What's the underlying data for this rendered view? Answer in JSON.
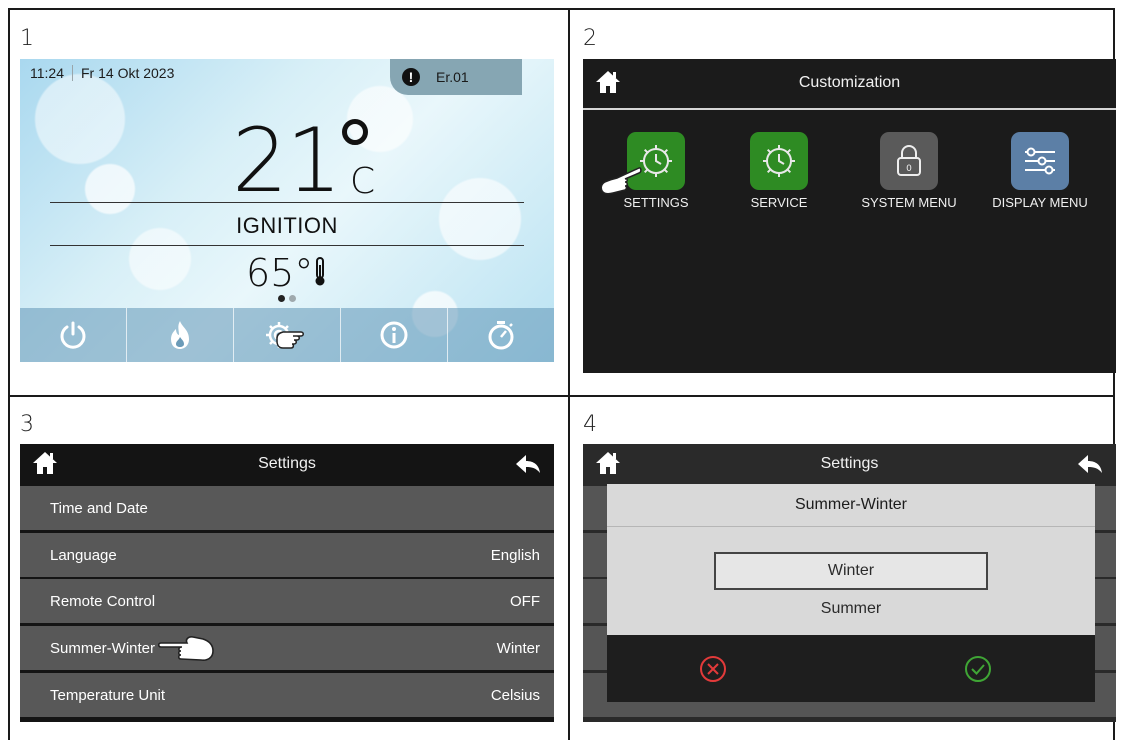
{
  "panels": {
    "labels": [
      "1",
      "2",
      "3",
      "4"
    ]
  },
  "panel1": {
    "time": "11:24",
    "date": "Fr 14 Okt 2023",
    "error_code": "Er.01",
    "room_temp": "21",
    "temp_unit": "C",
    "status": "IGNITION",
    "water_temp": "65°",
    "bottom_bar": [
      "power-icon",
      "flame-icon",
      "settings-gear-icon",
      "info-icon",
      "timer-icon"
    ],
    "page_indicator": {
      "count": 2,
      "active": 1
    }
  },
  "panel2": {
    "title": "Customization",
    "tiles": [
      {
        "label": "SETTINGS",
        "icon": "gear-clock-icon",
        "color": "#2e8b23"
      },
      {
        "label": "SERVICE",
        "icon": "gear-clock-icon",
        "color": "#2e8b23"
      },
      {
        "label": "SYSTEM MENU",
        "icon": "lock-icon",
        "color": "#5a5a5a"
      },
      {
        "label": "DISPLAY MENU",
        "icon": "sliders-icon",
        "color": "#5c7fa6"
      }
    ]
  },
  "panel3": {
    "title": "Settings",
    "rows": [
      {
        "label": "Time and Date",
        "value": ""
      },
      {
        "label": "Language",
        "value": "English"
      },
      {
        "label": "Remote Control",
        "value": "OFF"
      },
      {
        "label": "Summer-Winter",
        "value": "Winter"
      },
      {
        "label": "Temperature Unit",
        "value": "Celsius"
      }
    ]
  },
  "panel4": {
    "title": "Settings",
    "dialog_title": "Summer-Winter",
    "options": [
      "Winter",
      "Summer"
    ],
    "selected": "Winter",
    "cancel_icon": "cancel-x-icon",
    "confirm_icon": "confirm-check-icon"
  },
  "colors": {
    "accent_green": "#2e8b23",
    "cancel_red": "#e23a3a",
    "confirm_green": "#3fa535"
  }
}
